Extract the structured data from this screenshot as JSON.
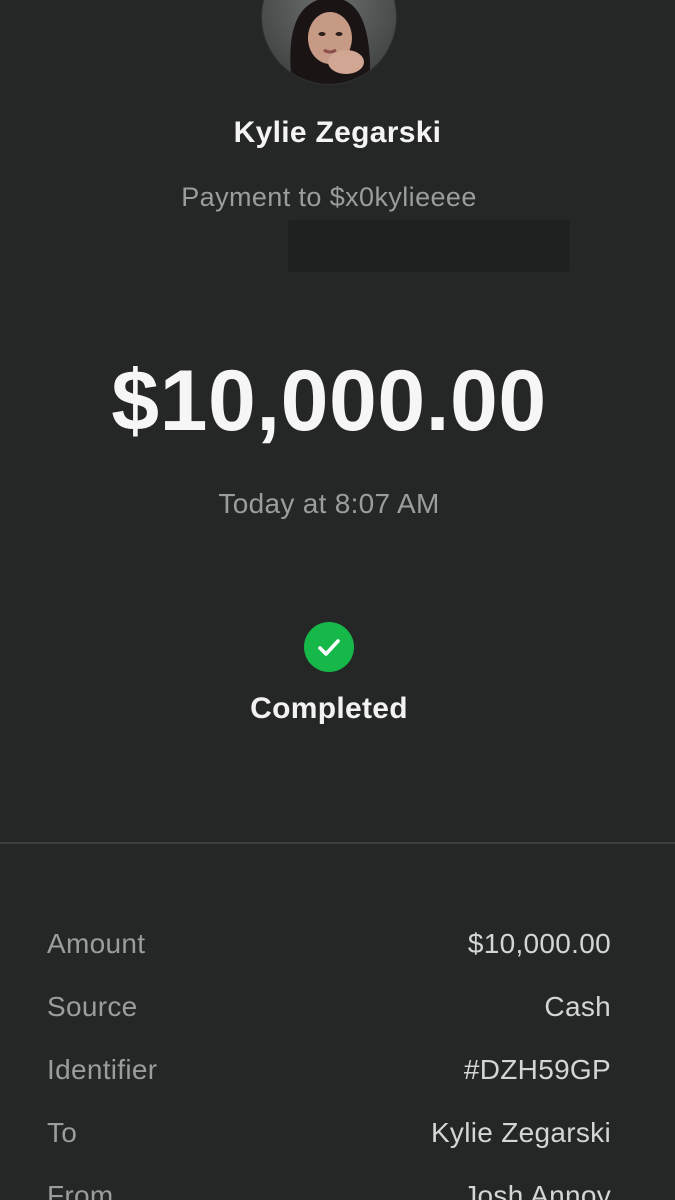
{
  "recipient": {
    "name": "Kylie Zegarski",
    "subtitle": "Payment to $x0kylieeee"
  },
  "payment": {
    "amount": "$10,000.00",
    "timestamp": "Today at 8:07 AM",
    "status": "Completed"
  },
  "details": [
    {
      "label": "Amount",
      "value": "$10,000.00"
    },
    {
      "label": "Source",
      "value": "Cash"
    },
    {
      "label": "Identifier",
      "value": "#DZH59GP"
    },
    {
      "label": "To",
      "value": "Kylie Zegarski"
    },
    {
      "label": "From",
      "value": "Josh Annoy"
    }
  ],
  "colors": {
    "background": "#242725",
    "success": "#16b84a",
    "muted_text": "#9a9d9c",
    "primary_text": "#f6f6f6"
  },
  "icons": {
    "status_icon": "checkmark-circle-icon",
    "avatar": "profile-photo"
  }
}
